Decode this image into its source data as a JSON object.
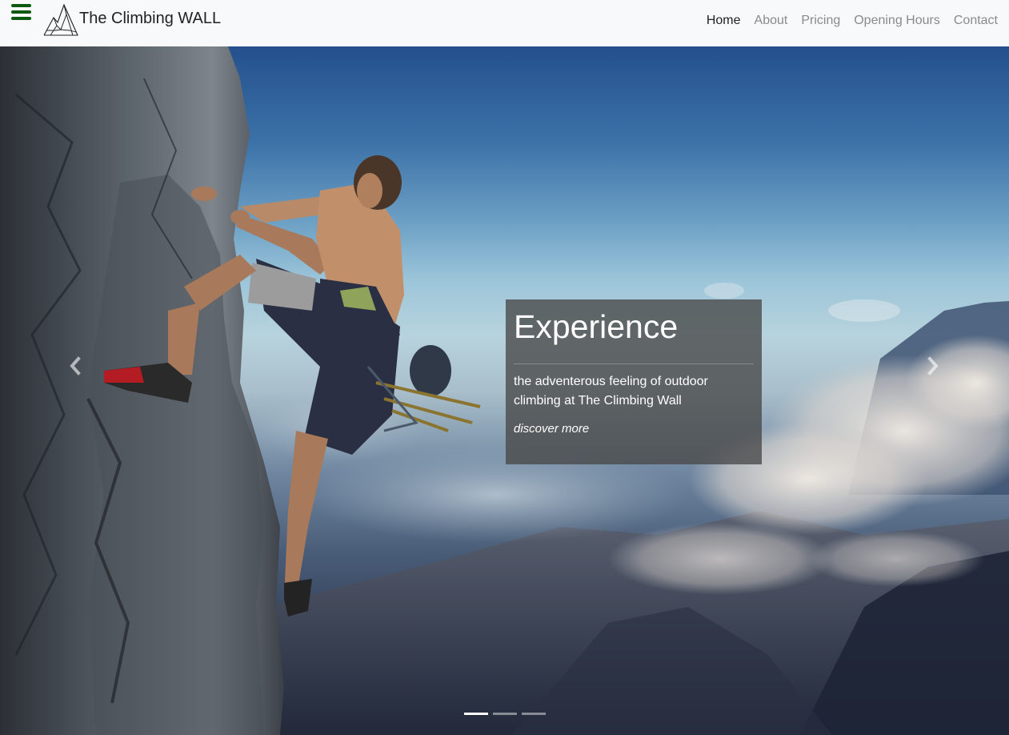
{
  "brand": {
    "name": "The Climbing WALL",
    "logo_icon": "mountain-logo-icon"
  },
  "menu_icon": "hamburger-menu-icon",
  "nav": {
    "items": [
      {
        "label": "Home",
        "active": true
      },
      {
        "label": "About",
        "active": false
      },
      {
        "label": "Pricing",
        "active": false
      },
      {
        "label": "Opening Hours",
        "active": false
      },
      {
        "label": "Contact",
        "active": false
      }
    ]
  },
  "carousel": {
    "caption": {
      "title": "Experience",
      "text": "the adventerous feeling of outdoor climbing at The Climbing Wall",
      "link": "discover more"
    },
    "slide_count": 3,
    "active_slide": 1,
    "prev_icon": "chevron-left-icon",
    "next_icon": "chevron-right-icon"
  },
  "colors": {
    "accent": "#0c5a12",
    "navbar_bg": "#f8f9fa",
    "nav_active": "#222222",
    "nav_inactive": "#8a8a8a"
  }
}
